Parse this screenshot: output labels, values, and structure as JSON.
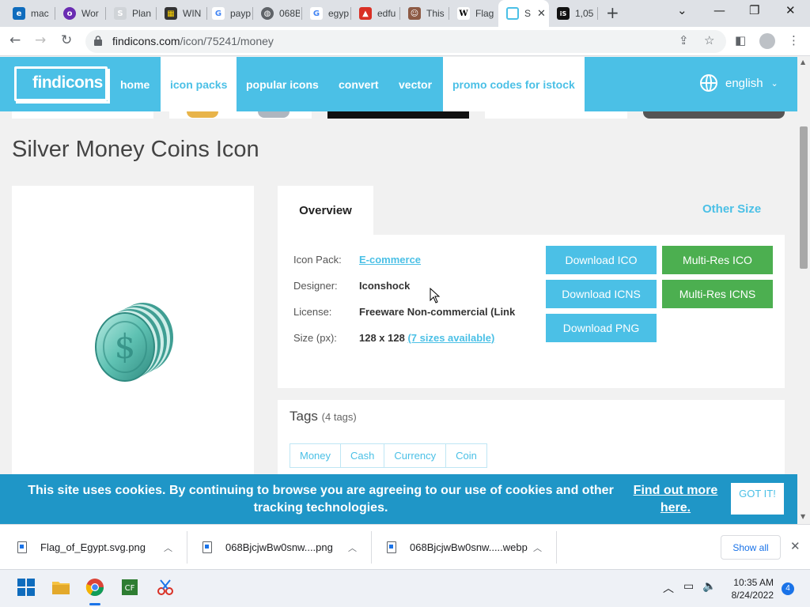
{
  "browser": {
    "tabs": [
      {
        "title": "mac",
        "icon": "edge-icon",
        "color": "#0f6cbd",
        "glyph": "e"
      },
      {
        "title": "Wor",
        "icon": "onion-icon",
        "color": "#6a2cb2",
        "glyph": "o"
      },
      {
        "title": "Plan",
        "icon": "s-icon",
        "color": "#d0d4d8",
        "glyph": "S"
      },
      {
        "title": "WIN",
        "icon": "film-icon",
        "color": "#333333",
        "glyph": "▦"
      },
      {
        "title": "payp",
        "icon": "google-icon",
        "color": "#4285f4",
        "glyph": "G"
      },
      {
        "title": "068B",
        "icon": "globe-icon",
        "color": "#5f6368",
        "glyph": "◍"
      },
      {
        "title": "egyp",
        "icon": "google-icon",
        "color": "#4285f4",
        "glyph": "G"
      },
      {
        "title": "edfu",
        "icon": "pdf-icon",
        "color": "#d93025",
        "glyph": "▲"
      },
      {
        "title": "This",
        "icon": "portrait-icon",
        "color": "#8d5a44",
        "glyph": "☺"
      },
      {
        "title": "Flag",
        "icon": "wikipedia-icon",
        "color": "#ffffff",
        "glyph": "W"
      },
      {
        "title": "S",
        "icon": "findicons-icon",
        "color": "#4bc0e6",
        "glyph": "▭"
      },
      {
        "title": "1,05",
        "icon": "istock-icon",
        "color": "#111111",
        "glyph": "iS"
      }
    ],
    "new_tab": "+",
    "url_host": "findicons.com",
    "url_path": "/icon/75241/money"
  },
  "site": {
    "logo": "findicons",
    "nav": [
      {
        "label": "home"
      },
      {
        "label": "icon packs"
      },
      {
        "label": "popular icons"
      },
      {
        "label": "convert"
      },
      {
        "label": "vector"
      },
      {
        "label": "promo codes for istock"
      }
    ],
    "language": "english"
  },
  "page": {
    "title": "Silver Money Coins Icon",
    "tab_overview": "Overview",
    "tab_other_size": "Other Size",
    "info": {
      "pack_label": "Icon Pack:",
      "pack_value": "E-commerce",
      "designer_label": "Designer:",
      "designer_value": "Iconshock",
      "license_label": "License:",
      "license_value": "Freeware Non-commercial (Link",
      "size_label": "Size (px):",
      "size_value": "128 x 128",
      "size_link": "(7 sizes available)"
    },
    "buttons": {
      "download_ico": "Download ICO",
      "download_icns": "Download ICNS",
      "download_png": "Download PNG",
      "multires_ico": "Multi-Res ICO",
      "multires_icns": "Multi-Res ICNS"
    },
    "tags_title": "Tags",
    "tags_count": "(4 tags)",
    "tags": [
      "Money",
      "Cash",
      "Currency",
      "Coin"
    ]
  },
  "cookie": {
    "text": "This site uses cookies. By continuing to browse you are agreeing to our use of cookies and other tracking technologies.",
    "link": "Find out more here.",
    "button": "GOT IT!"
  },
  "downloads": {
    "items": [
      {
        "name": "Flag_of_Egypt.svg.png"
      },
      {
        "name": "068BjcjwBw0snw....png"
      },
      {
        "name": "068BjcjwBw0snw.....webp"
      }
    ],
    "show_all": "Show all"
  },
  "taskbar": {
    "time": "10:35 AM",
    "date": "8/24/2022",
    "notifications": "4"
  },
  "colors": {
    "brand": "#4bc0e6",
    "green": "#4caf50",
    "cookie_bar": "#1f96c7"
  }
}
